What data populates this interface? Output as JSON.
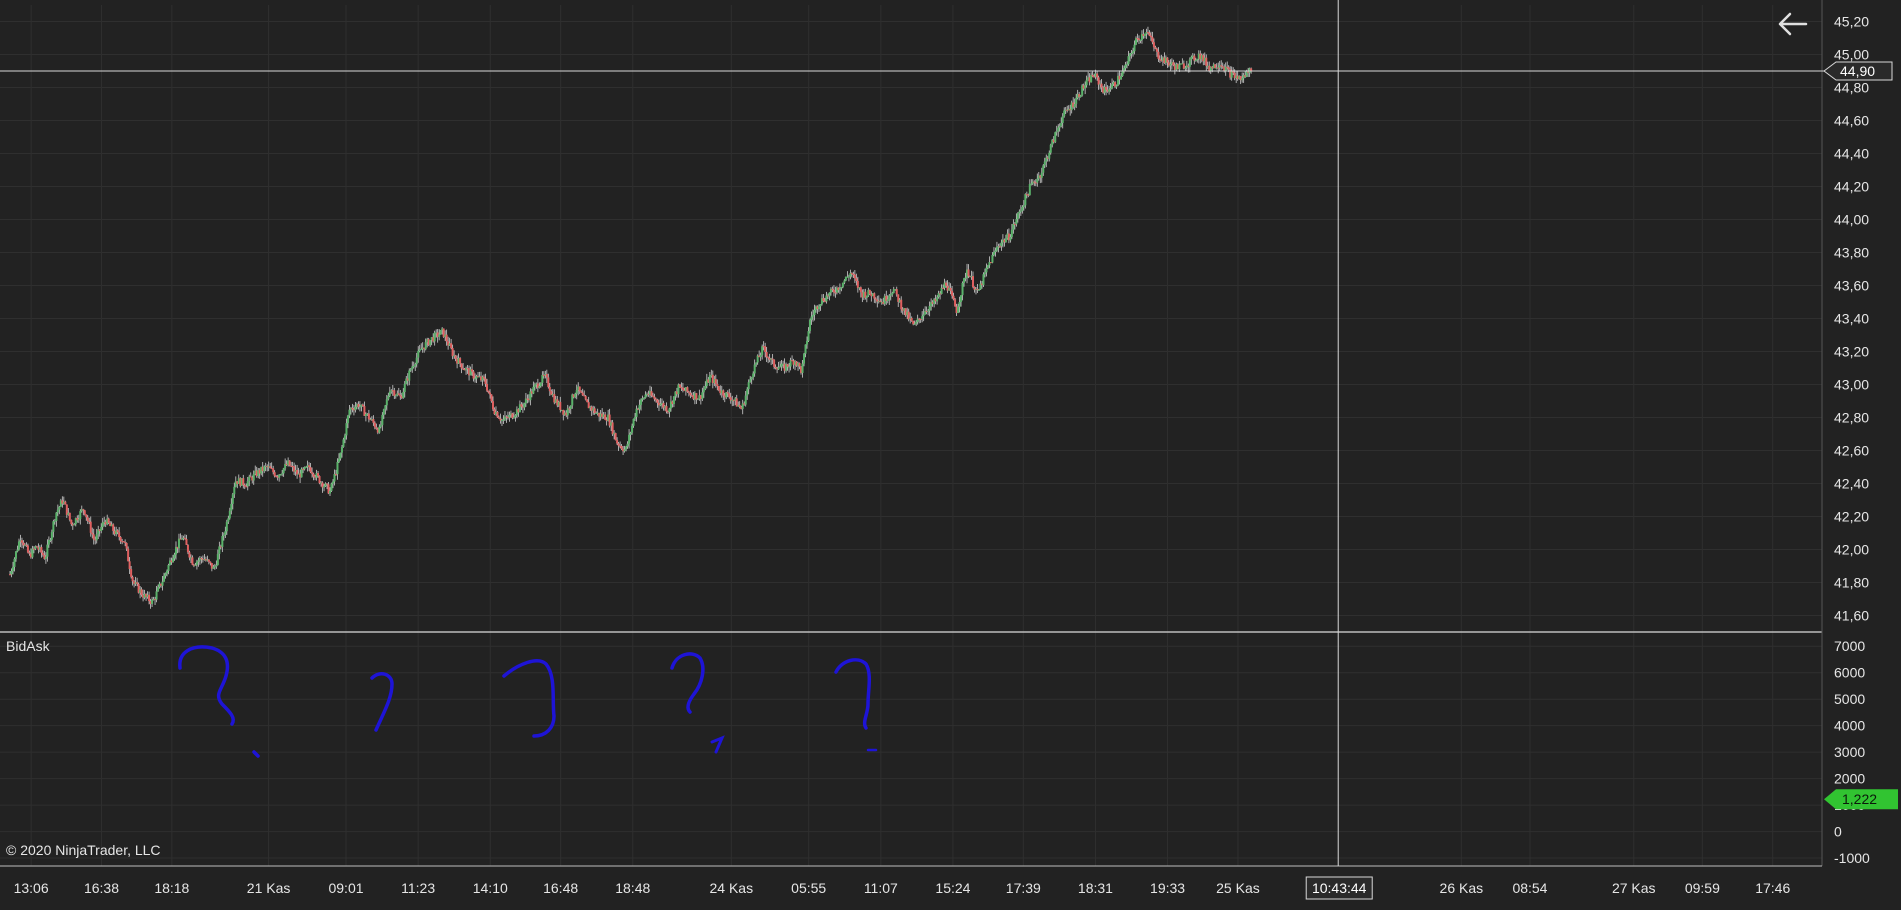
{
  "chart_data": [
    {
      "type": "candlestick",
      "panel": "price",
      "ylim": [
        41.5,
        45.3
      ],
      "y_ticks": [
        "41,60",
        "41,80",
        "42,00",
        "42,20",
        "42,40",
        "42,60",
        "42,80",
        "43,00",
        "43,20",
        "43,40",
        "43,60",
        "43,80",
        "44,00",
        "44,20",
        "44,40",
        "44,60",
        "44,80",
        "45,00",
        "45,20"
      ],
      "y_tick_values": [
        41.6,
        41.8,
        42.0,
        42.2,
        42.4,
        42.6,
        42.8,
        43.0,
        43.2,
        43.4,
        43.6,
        43.8,
        44.0,
        44.2,
        44.4,
        44.6,
        44.8,
        45.0,
        45.2
      ],
      "price_line": {
        "value": 44.9,
        "label": "44,90"
      },
      "series_path": [
        [
          0.0,
          41.85
        ],
        [
          0.6,
          42.08
        ],
        [
          1.1,
          41.96
        ],
        [
          1.5,
          42.02
        ],
        [
          2.0,
          41.95
        ],
        [
          2.6,
          42.22
        ],
        [
          3.0,
          42.3
        ],
        [
          3.5,
          42.15
        ],
        [
          4.2,
          42.25
        ],
        [
          4.8,
          42.05
        ],
        [
          5.4,
          42.18
        ],
        [
          6.0,
          42.1
        ],
        [
          6.5,
          42.05
        ],
        [
          7.0,
          41.8
        ],
        [
          7.6,
          41.72
        ],
        [
          8.1,
          41.68
        ],
        [
          8.7,
          41.82
        ],
        [
          9.3,
          41.98
        ],
        [
          9.8,
          42.08
        ],
        [
          10.4,
          41.92
        ],
        [
          11.0,
          41.95
        ],
        [
          11.6,
          41.88
        ],
        [
          12.3,
          42.15
        ],
        [
          12.8,
          42.42
        ],
        [
          13.4,
          42.4
        ],
        [
          14.0,
          42.46
        ],
        [
          14.6,
          42.5
        ],
        [
          15.2,
          42.45
        ],
        [
          15.8,
          42.52
        ],
        [
          16.4,
          42.45
        ],
        [
          17.0,
          42.5
        ],
        [
          17.6,
          42.42
        ],
        [
          18.2,
          42.35
        ],
        [
          18.8,
          42.58
        ],
        [
          19.3,
          42.85
        ],
        [
          19.8,
          42.88
        ],
        [
          20.4,
          42.8
        ],
        [
          21.0,
          42.72
        ],
        [
          21.6,
          42.98
        ],
        [
          22.2,
          42.92
        ],
        [
          22.8,
          43.1
        ],
        [
          23.4,
          43.22
        ],
        [
          24.0,
          43.28
        ],
        [
          24.6,
          43.32
        ],
        [
          25.2,
          43.18
        ],
        [
          25.8,
          43.1
        ],
        [
          26.4,
          43.05
        ],
        [
          27.0,
          43.02
        ],
        [
          27.5,
          42.85
        ],
        [
          28.0,
          42.78
        ],
        [
          28.6,
          42.82
        ],
        [
          29.2,
          42.88
        ],
        [
          29.8,
          42.98
        ],
        [
          30.4,
          43.05
        ],
        [
          31.0,
          42.9
        ],
        [
          31.6,
          42.82
        ],
        [
          32.2,
          42.98
        ],
        [
          32.8,
          42.88
        ],
        [
          33.4,
          42.82
        ],
        [
          34.0,
          42.8
        ],
        [
          34.5,
          42.65
        ],
        [
          35.0,
          42.6
        ],
        [
          35.6,
          42.85
        ],
        [
          36.2,
          42.95
        ],
        [
          36.8,
          42.9
        ],
        [
          37.4,
          42.85
        ],
        [
          38.0,
          42.98
        ],
        [
          38.6,
          42.95
        ],
        [
          39.2,
          42.92
        ],
        [
          39.8,
          43.05
        ],
        [
          40.4,
          42.96
        ],
        [
          41.0,
          42.92
        ],
        [
          41.6,
          42.85
        ],
        [
          42.2,
          43.08
        ],
        [
          42.8,
          43.22
        ],
        [
          43.4,
          43.12
        ],
        [
          44.0,
          43.1
        ],
        [
          44.6,
          43.15
        ],
        [
          45.0,
          43.08
        ],
        [
          45.5,
          43.4
        ],
        [
          46.0,
          43.5
        ],
        [
          46.6,
          43.55
        ],
        [
          47.2,
          43.6
        ],
        [
          47.8,
          43.68
        ],
        [
          48.4,
          43.55
        ],
        [
          49.0,
          43.55
        ],
        [
          49.6,
          43.5
        ],
        [
          50.2,
          43.58
        ],
        [
          50.8,
          43.45
        ],
        [
          51.4,
          43.35
        ],
        [
          52.0,
          43.45
        ],
        [
          52.6,
          43.5
        ],
        [
          53.2,
          43.62
        ],
        [
          53.8,
          43.45
        ],
        [
          54.4,
          43.7
        ],
        [
          55.0,
          43.55
        ],
        [
          55.6,
          43.72
        ],
        [
          56.2,
          43.85
        ],
        [
          56.8,
          43.9
        ],
        [
          57.4,
          44.05
        ],
        [
          58.0,
          44.2
        ],
        [
          58.6,
          44.28
        ],
        [
          59.2,
          44.45
        ],
        [
          59.8,
          44.62
        ],
        [
          60.4,
          44.7
        ],
        [
          61.0,
          44.8
        ],
        [
          61.6,
          44.88
        ],
        [
          62.2,
          44.78
        ],
        [
          62.8,
          44.82
        ],
        [
          63.4,
          44.92
        ],
        [
          64.0,
          45.08
        ],
        [
          64.6,
          45.15
        ],
        [
          65.2,
          45.0
        ],
        [
          65.8,
          44.95
        ],
        [
          66.4,
          44.92
        ],
        [
          67.0,
          44.95
        ],
        [
          67.6,
          45.0
        ],
        [
          68.2,
          44.92
        ],
        [
          68.8,
          44.95
        ],
        [
          69.4,
          44.88
        ],
        [
          70.0,
          44.85
        ],
        [
          70.6,
          44.92
        ]
      ]
    },
    {
      "type": "bar",
      "panel": "BidAsk",
      "title": "BidAsk",
      "ylim": [
        -1300,
        7500
      ],
      "y_ticks": [
        "-1000",
        "0",
        "1000",
        "2000",
        "3000",
        "4000",
        "5000",
        "6000",
        "7000"
      ],
      "y_tick_values": [
        -1000,
        0,
        1000,
        2000,
        3000,
        4000,
        5000,
        6000,
        7000
      ],
      "current_value": {
        "value": 1222,
        "label": "1,222"
      }
    }
  ],
  "x_axis": {
    "labels": [
      {
        "text": "13:06",
        "i": 1.2
      },
      {
        "text": "16:38",
        "i": 5.2
      },
      {
        "text": "18:18",
        "i": 9.2
      },
      {
        "text": "21 Kas",
        "i": 14.7
      },
      {
        "text": "09:01",
        "i": 19.1
      },
      {
        "text": "11:23",
        "i": 23.2
      },
      {
        "text": "14:10",
        "i": 27.3
      },
      {
        "text": "16:48",
        "i": 31.3
      },
      {
        "text": "18:48",
        "i": 35.4
      },
      {
        "text": "24 Kas",
        "i": 41.0
      },
      {
        "text": "05:55",
        "i": 45.4
      },
      {
        "text": "11:07",
        "i": 49.5
      },
      {
        "text": "15:24",
        "i": 53.6
      },
      {
        "text": "17:39",
        "i": 57.6
      },
      {
        "text": "18:31",
        "i": 61.7
      },
      {
        "text": "19:33",
        "i": 65.8
      },
      {
        "text": "25 Kas",
        "i": 69.8
      },
      {
        "text": "26 Kas",
        "i": 82.5
      },
      {
        "text": "08:54",
        "i": 86.4
      },
      {
        "text": "27 Kas",
        "i": 92.3
      },
      {
        "text": "09:59",
        "i": 96.2
      },
      {
        "text": "17:46",
        "i": 100.2
      }
    ],
    "crosshair_i": 75.5,
    "crosshair_label": "10:43:44",
    "slots": 103
  },
  "copyright": "© 2020 NinjaTrader, LLC",
  "icons": {
    "back": "arrow-left-icon"
  },
  "colors": {
    "background": "#222222",
    "grid": "#2f2f2f",
    "axis_text": "#e6e6e6",
    "up": "#5ab26a",
    "down": "#e06060",
    "wick": "#cfcfcf",
    "price_line": "#d8d8d8",
    "value_badge": "#31c431",
    "annotation": "#1e14d6"
  }
}
